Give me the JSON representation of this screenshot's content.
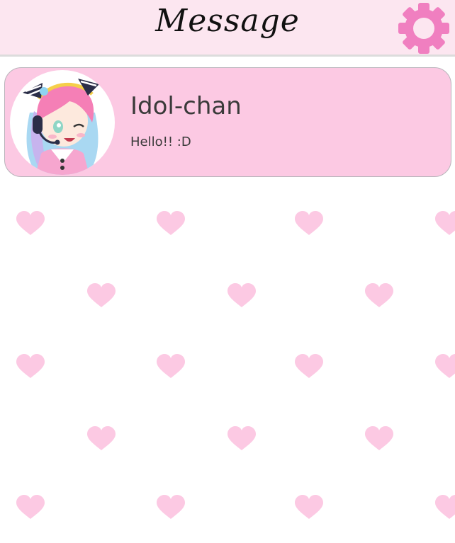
{
  "header": {
    "title": "Message",
    "settings_icon": "gear-icon"
  },
  "conversations": [
    {
      "name": "Idol-chan",
      "preview": "Hello!! :D",
      "avatar_icon": "avatar-idol-chan"
    }
  ],
  "colors": {
    "header_bg": "#fce6f0",
    "card_bg": "#fcc9e3",
    "heart": "#fcc9e3",
    "gear": "#f07fc0"
  },
  "background_pattern_icon": "heart-icon"
}
